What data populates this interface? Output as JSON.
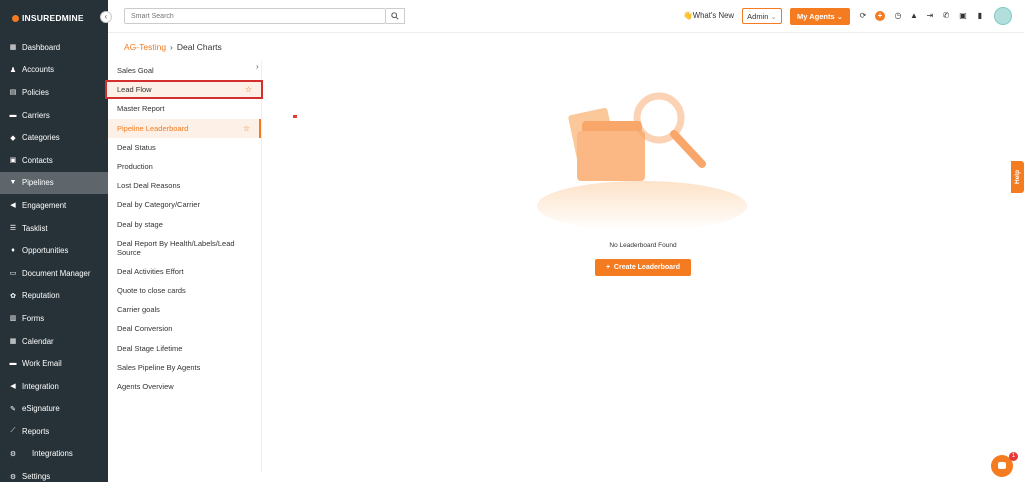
{
  "app": {
    "logo_text": "INSUREDMINE"
  },
  "sidebar": {
    "items": [
      {
        "label": "Dashboard",
        "icon": "dashboard-icon"
      },
      {
        "label": "Accounts",
        "icon": "accounts-icon"
      },
      {
        "label": "Policies",
        "icon": "policies-icon"
      },
      {
        "label": "Carriers",
        "icon": "carriers-icon"
      },
      {
        "label": "Categories",
        "icon": "categories-icon"
      },
      {
        "label": "Contacts",
        "icon": "contacts-icon"
      },
      {
        "label": "Pipelines",
        "icon": "pipelines-icon"
      },
      {
        "label": "Engagement",
        "icon": "engagement-icon"
      },
      {
        "label": "Tasklist",
        "icon": "tasklist-icon"
      },
      {
        "label": "Opportunities",
        "icon": "opportunities-icon"
      },
      {
        "label": "Document Manager",
        "icon": "folder-icon"
      },
      {
        "label": "Reputation",
        "icon": "reputation-icon"
      },
      {
        "label": "Forms",
        "icon": "forms-icon"
      },
      {
        "label": "Calendar",
        "icon": "calendar-icon"
      },
      {
        "label": "Work Email",
        "icon": "email-icon"
      },
      {
        "label": "Integration",
        "icon": "integration-icon"
      },
      {
        "label": "eSignature",
        "icon": "esignature-icon"
      },
      {
        "label": "Reports",
        "icon": "reports-icon"
      },
      {
        "label": "Integrations",
        "icon": "integrations-icon"
      },
      {
        "label": "Settings",
        "icon": "settings-icon"
      }
    ],
    "active": "Pipelines"
  },
  "topbar": {
    "search_placeholder": "Smart Search",
    "whats_new": "What's New",
    "admin_label": "Admin",
    "my_agents_label": "My Agents"
  },
  "breadcrumb": {
    "parent": "AG-Testing",
    "current": "Deal Charts"
  },
  "reports": {
    "items": [
      "Sales Goal",
      "Lead Flow",
      "Master Report",
      "Pipeline Leaderboard",
      "Deal Status",
      "Production",
      "Lost Deal Reasons",
      "Deal by Category/Carrier",
      "Deal by stage",
      "Deal Report By Health/Labels/Lead Source",
      "Deal Activities Effort",
      "Quote to close cards",
      "Carrier goals",
      "Deal Conversion",
      "Deal Stage Lifetime",
      "Sales Pipeline By Agents",
      "Agents Overview"
    ],
    "highlighted": "Lead Flow",
    "active": "Pipeline Leaderboard"
  },
  "main": {
    "empty_text": "No Leaderboard Found",
    "create_button": "Create Leaderboard"
  },
  "help_label": "Help",
  "chat_badge": "1",
  "colors": {
    "accent": "#f47b20",
    "sidebar_bg": "#263238",
    "highlight_border": "#d32f2f"
  }
}
